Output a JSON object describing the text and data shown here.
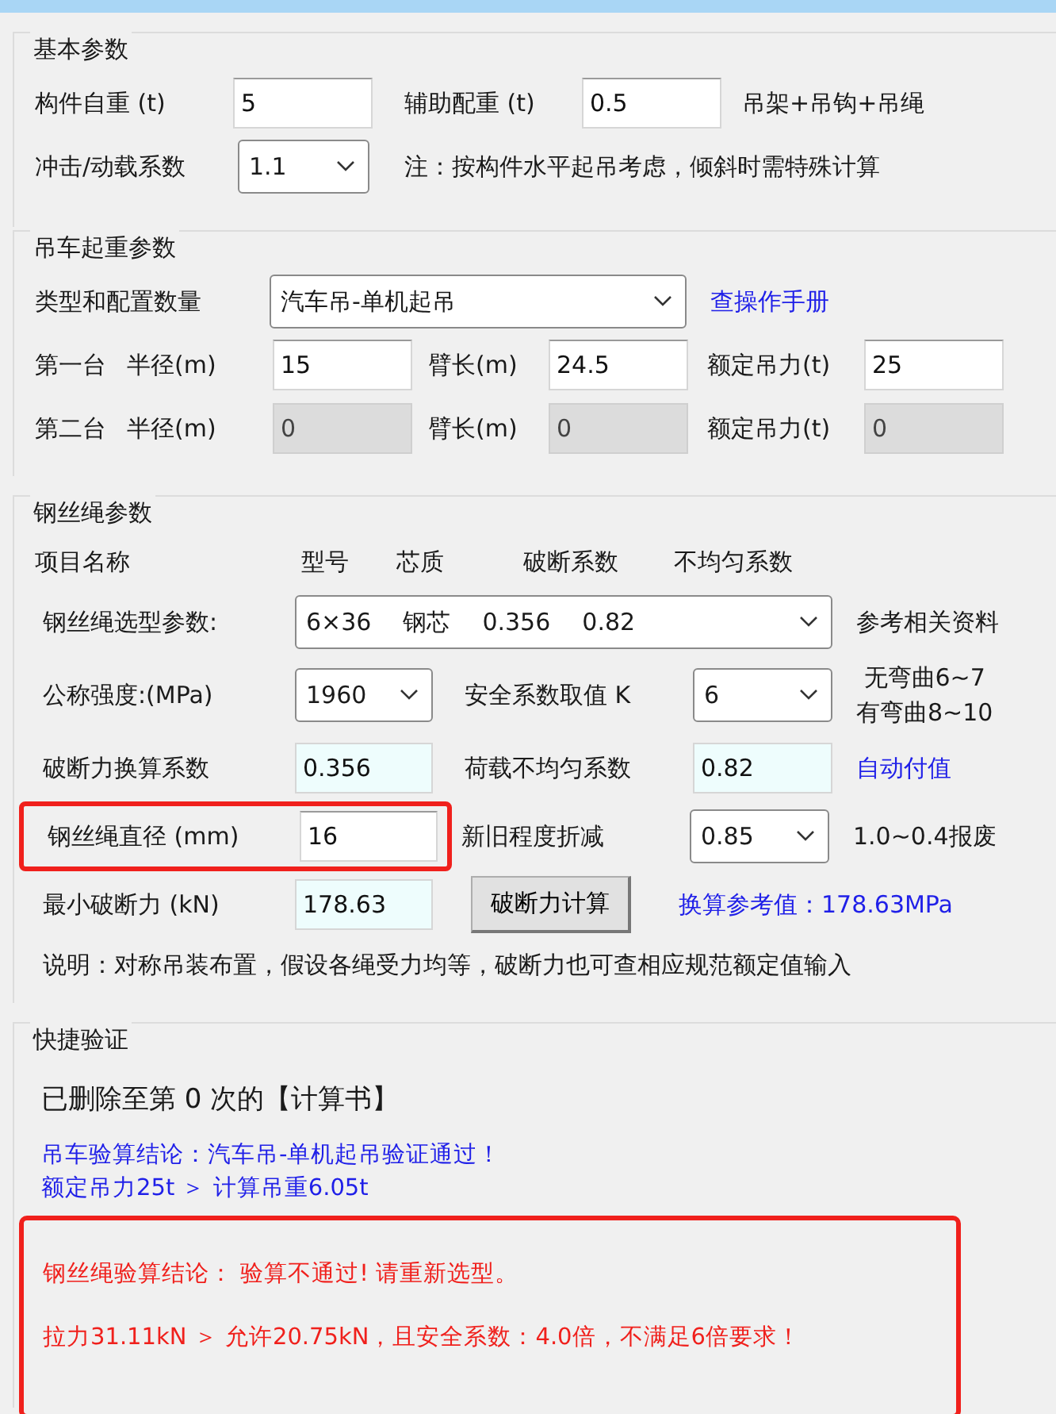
{
  "sections": [
    {
      "title": "基本参数",
      "rows": [
        {
          "items": [
            {
              "kind": "label",
              "text": "构件自重 (t)"
            },
            {
              "kind": "input",
              "value": "5"
            },
            {
              "kind": "label",
              "text": "辅助配重 (t)"
            },
            {
              "kind": "input",
              "value": "0.5"
            },
            {
              "kind": "note",
              "text": "吊架+吊钩+吊绳"
            }
          ]
        },
        {
          "items": [
            {
              "kind": "label",
              "text": "冲击/动载系数"
            },
            {
              "kind": "select",
              "parts": [
                "1.1"
              ]
            },
            {
              "kind": "note",
              "text": "注：按构件水平起吊考虑，倾斜时需特殊计算"
            }
          ]
        }
      ]
    },
    {
      "title": "吊车起重参数",
      "rows": [
        {
          "items": [
            {
              "kind": "label",
              "text": "类型和配置数量"
            },
            {
              "kind": "select",
              "parts": [
                "汽车吊-单机起吊"
              ]
            },
            {
              "kind": "link",
              "text": "查操作手册"
            }
          ]
        },
        {
          "items": [
            {
              "kind": "label",
              "text": "第一台"
            },
            {
              "kind": "label",
              "text": "半径(m)"
            },
            {
              "kind": "input",
              "value": "15"
            },
            {
              "kind": "label",
              "text": "臂长(m)"
            },
            {
              "kind": "input",
              "value": "24.5"
            },
            {
              "kind": "label",
              "text": "额定吊力(t)"
            },
            {
              "kind": "input",
              "value": "25"
            }
          ]
        },
        {
          "items": [
            {
              "kind": "label",
              "text": "第二台"
            },
            {
              "kind": "label",
              "text": "半径(m)"
            },
            {
              "kind": "readonly",
              "value": "0"
            },
            {
              "kind": "label",
              "text": "臂长(m)"
            },
            {
              "kind": "readonly",
              "value": "0"
            },
            {
              "kind": "label",
              "text": "额定吊力(t)"
            },
            {
              "kind": "readonly",
              "value": "0"
            }
          ]
        }
      ]
    },
    {
      "title": "钢丝绳参数",
      "rows": [
        {
          "items": [
            {
              "kind": "label",
              "text": "项目名称"
            },
            {
              "kind": "label",
              "text": "型号"
            },
            {
              "kind": "label",
              "text": "芯质"
            },
            {
              "kind": "label",
              "text": "破断系数"
            },
            {
              "kind": "label",
              "text": "不均匀系数"
            }
          ]
        },
        {
          "items": [
            {
              "kind": "label",
              "text": "钢丝绳选型参数:"
            },
            {
              "kind": "select",
              "parts": [
                "6×36",
                "钢芯",
                "0.356",
                "0.82"
              ]
            },
            {
              "kind": "note",
              "text": "参考相关资料"
            }
          ]
        },
        {
          "items": [
            {
              "kind": "label",
              "text": "公称强度:(MPa)"
            },
            {
              "kind": "select",
              "parts": [
                "1960"
              ]
            },
            {
              "kind": "label",
              "text": "安全系数取值 K"
            },
            {
              "kind": "select",
              "parts": [
                "6"
              ]
            },
            {
              "kind": "notes",
              "lines": [
                "无弯曲6~7",
                "有弯曲8~10"
              ]
            }
          ]
        },
        {
          "items": [
            {
              "kind": "label",
              "text": "破断力换算系数"
            },
            {
              "kind": "computed",
              "value": "0.356"
            },
            {
              "kind": "label",
              "text": "荷载不均匀系数"
            },
            {
              "kind": "computed",
              "value": "0.82"
            },
            {
              "kind": "link",
              "text": "自动付值"
            }
          ]
        },
        {
          "items": [
            {
              "kind": "group",
              "highlighted": true,
              "items": [
                {
                  "kind": "label",
                  "text": "钢丝绳直径 (mm)"
                },
                {
                  "kind": "input",
                  "value": "16"
                }
              ]
            },
            {
              "kind": "label",
              "text": "新旧程度折减"
            },
            {
              "kind": "select",
              "parts": [
                "0.85"
              ]
            },
            {
              "kind": "note",
              "text": "1.0~0.4报废"
            }
          ]
        },
        {
          "items": [
            {
              "kind": "label",
              "text": "最小破断力 (kN)"
            },
            {
              "kind": "computed",
              "value": "178.63"
            },
            {
              "kind": "button",
              "text": "破断力计算"
            },
            {
              "kind": "link",
              "text": "换算参考值：178.63MPa"
            }
          ]
        },
        {
          "items": [
            {
              "kind": "note",
              "text": "说明：对称吊装布置，假设各绳受力均等，破断力也可查相应规范额定值输入"
            }
          ]
        }
      ]
    }
  ],
  "check": {
    "title": "快捷验证",
    "status": "已删除至第 0 次的【计算书】",
    "results": [
      {
        "passed": true,
        "highlighted": false,
        "lines": [
          "吊车验算结论：汽车吊-单机起吊验证通过！",
          "额定吊力25t ＞ 计算吊重6.05t"
        ]
      },
      {
        "passed": false,
        "highlighted": true,
        "lines": [
          "钢丝绳验算结论：  验算不通过! 请重新选型。",
          "拉力31.11kN ＞ 允许20.75kN，且安全系数：4.0倍，不满足6倍要求！"
        ]
      }
    ]
  }
}
